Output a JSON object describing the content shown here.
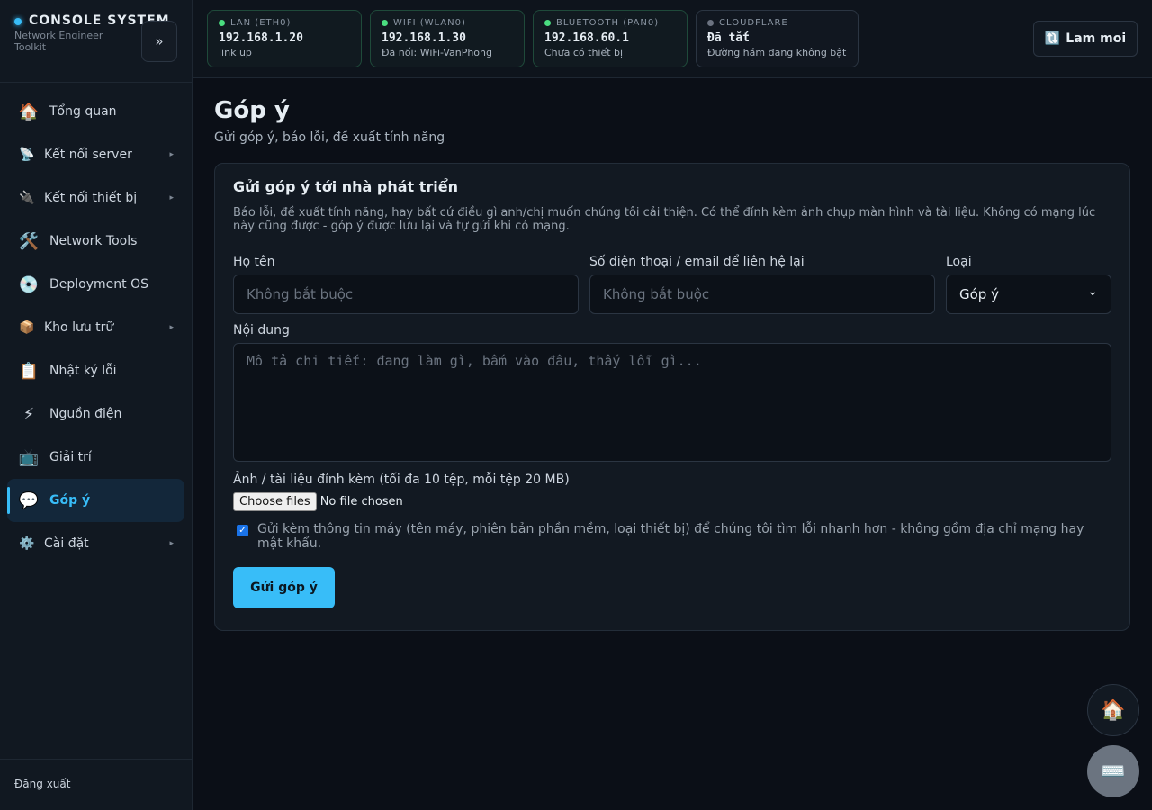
{
  "brand": {
    "title": "CONSOLE SYSTEM",
    "subtitle": "Network Engineer Toolkit",
    "collapse_icon": "»"
  },
  "sidebar": {
    "items": [
      {
        "label": "Tổng quan",
        "icon": "🏠",
        "has_arrow": false
      },
      {
        "label": "Kết nối server",
        "icon": "📡",
        "has_arrow": true
      },
      {
        "label": "Kết nối thiết bị",
        "icon": "🔌",
        "has_arrow": true
      },
      {
        "label": "Network Tools",
        "icon": "🛠️",
        "has_arrow": false
      },
      {
        "label": "Deployment OS",
        "icon": "💿",
        "has_arrow": false
      },
      {
        "label": "Kho lưu trữ",
        "icon": "📦",
        "has_arrow": true
      },
      {
        "label": "Nhật ký lỗi",
        "icon": "📋",
        "has_arrow": false
      },
      {
        "label": "Nguồn điện",
        "icon": "⚡",
        "has_arrow": false
      },
      {
        "label": "Giải trí",
        "icon": "📺",
        "has_arrow": false
      },
      {
        "label": "Góp ý",
        "icon": "💬",
        "has_arrow": false,
        "active": true
      },
      {
        "label": "Cài đặt",
        "icon": "⚙️",
        "has_arrow": true
      }
    ],
    "arrow_glyph": "▸",
    "logout": "Đăng xuất"
  },
  "topbar": {
    "cards": [
      {
        "name": "LAN (ETH0)",
        "value": "192.168.1.20",
        "sub": "link up",
        "status": "up"
      },
      {
        "name": "WIFI (WLAN0)",
        "value": "192.168.1.30",
        "sub": "Đã nối: WiFi-VanPhong",
        "status": "up"
      },
      {
        "name": "BLUETOOTH (PAN0)",
        "value": "192.168.60.1",
        "sub": "Chưa có thiết bị",
        "status": "up"
      },
      {
        "name": "CLOUDFLARE",
        "value": "Đã tắt",
        "sub": "Đường hầm đang không bật",
        "status": "off"
      }
    ],
    "refresh_icon": "🔃",
    "refresh_label": "Lam moi"
  },
  "page": {
    "title": "Góp ý",
    "subtitle": "Gửi góp ý, báo lỗi, đề xuất tính năng"
  },
  "form": {
    "title": "Gửi góp ý tới nhà phát triển",
    "description": "Báo lỗi, đề xuất tính năng, hay bất cứ điều gì anh/chị muốn chúng tôi cải thiện. Có thể đính kèm ảnh chụp màn hình và tài liệu. Không có mạng lúc này cũng được - góp ý được lưu lại và tự gửi khi có mạng.",
    "name_label": "Họ tên",
    "name_placeholder": "Không bắt buộc",
    "contact_label": "Số điện thoại / email để liên hệ lại",
    "contact_placeholder": "Không bắt buộc",
    "type_label": "Loại",
    "type_value": "Góp ý",
    "type_chevron": "⌄",
    "content_label": "Nội dung",
    "content_placeholder": "Mô tả chi tiết: đang làm gì, bấm vào đâu, thấy lỗi gì...",
    "attach_label": "Ảnh / tài liệu đính kèm (tối đa 10 tệp, mỗi tệp 20 MB)",
    "file_button": "Choose files",
    "file_status": "No file chosen",
    "include_info_checked": true,
    "include_info_label": "Gửi kèm thông tin máy (tên máy, phiên bản phần mềm, loại thiết bị) để chúng tôi tìm lỗi nhanh hơn - không gồm địa chỉ mạng hay mật khẩu.",
    "submit_label": "Gửi góp ý"
  },
  "fabs": {
    "home_icon": "🏠",
    "keyboard_icon": "⌨️"
  }
}
